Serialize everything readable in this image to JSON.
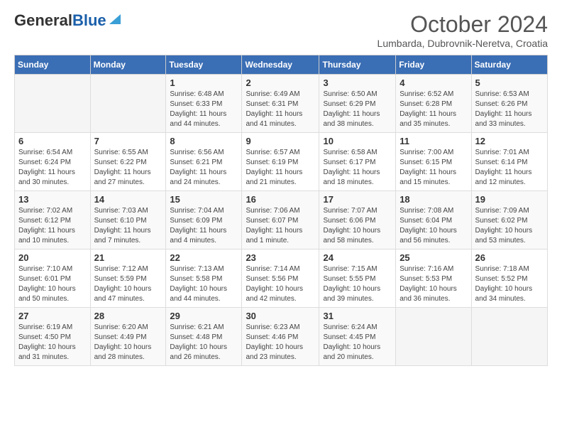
{
  "header": {
    "logo_general": "General",
    "logo_blue": "Blue",
    "month": "October 2024",
    "location": "Lumbarda, Dubrovnik-Neretva, Croatia"
  },
  "days_of_week": [
    "Sunday",
    "Monday",
    "Tuesday",
    "Wednesday",
    "Thursday",
    "Friday",
    "Saturday"
  ],
  "weeks": [
    [
      {
        "day": "",
        "info": ""
      },
      {
        "day": "",
        "info": ""
      },
      {
        "day": "1",
        "info": "Sunrise: 6:48 AM\nSunset: 6:33 PM\nDaylight: 11 hours and 44 minutes."
      },
      {
        "day": "2",
        "info": "Sunrise: 6:49 AM\nSunset: 6:31 PM\nDaylight: 11 hours and 41 minutes."
      },
      {
        "day": "3",
        "info": "Sunrise: 6:50 AM\nSunset: 6:29 PM\nDaylight: 11 hours and 38 minutes."
      },
      {
        "day": "4",
        "info": "Sunrise: 6:52 AM\nSunset: 6:28 PM\nDaylight: 11 hours and 35 minutes."
      },
      {
        "day": "5",
        "info": "Sunrise: 6:53 AM\nSunset: 6:26 PM\nDaylight: 11 hours and 33 minutes."
      }
    ],
    [
      {
        "day": "6",
        "info": "Sunrise: 6:54 AM\nSunset: 6:24 PM\nDaylight: 11 hours and 30 minutes."
      },
      {
        "day": "7",
        "info": "Sunrise: 6:55 AM\nSunset: 6:22 PM\nDaylight: 11 hours and 27 minutes."
      },
      {
        "day": "8",
        "info": "Sunrise: 6:56 AM\nSunset: 6:21 PM\nDaylight: 11 hours and 24 minutes."
      },
      {
        "day": "9",
        "info": "Sunrise: 6:57 AM\nSunset: 6:19 PM\nDaylight: 11 hours and 21 minutes."
      },
      {
        "day": "10",
        "info": "Sunrise: 6:58 AM\nSunset: 6:17 PM\nDaylight: 11 hours and 18 minutes."
      },
      {
        "day": "11",
        "info": "Sunrise: 7:00 AM\nSunset: 6:15 PM\nDaylight: 11 hours and 15 minutes."
      },
      {
        "day": "12",
        "info": "Sunrise: 7:01 AM\nSunset: 6:14 PM\nDaylight: 11 hours and 12 minutes."
      }
    ],
    [
      {
        "day": "13",
        "info": "Sunrise: 7:02 AM\nSunset: 6:12 PM\nDaylight: 11 hours and 10 minutes."
      },
      {
        "day": "14",
        "info": "Sunrise: 7:03 AM\nSunset: 6:10 PM\nDaylight: 11 hours and 7 minutes."
      },
      {
        "day": "15",
        "info": "Sunrise: 7:04 AM\nSunset: 6:09 PM\nDaylight: 11 hours and 4 minutes."
      },
      {
        "day": "16",
        "info": "Sunrise: 7:06 AM\nSunset: 6:07 PM\nDaylight: 11 hours and 1 minute."
      },
      {
        "day": "17",
        "info": "Sunrise: 7:07 AM\nSunset: 6:06 PM\nDaylight: 10 hours and 58 minutes."
      },
      {
        "day": "18",
        "info": "Sunrise: 7:08 AM\nSunset: 6:04 PM\nDaylight: 10 hours and 56 minutes."
      },
      {
        "day": "19",
        "info": "Sunrise: 7:09 AM\nSunset: 6:02 PM\nDaylight: 10 hours and 53 minutes."
      }
    ],
    [
      {
        "day": "20",
        "info": "Sunrise: 7:10 AM\nSunset: 6:01 PM\nDaylight: 10 hours and 50 minutes."
      },
      {
        "day": "21",
        "info": "Sunrise: 7:12 AM\nSunset: 5:59 PM\nDaylight: 10 hours and 47 minutes."
      },
      {
        "day": "22",
        "info": "Sunrise: 7:13 AM\nSunset: 5:58 PM\nDaylight: 10 hours and 44 minutes."
      },
      {
        "day": "23",
        "info": "Sunrise: 7:14 AM\nSunset: 5:56 PM\nDaylight: 10 hours and 42 minutes."
      },
      {
        "day": "24",
        "info": "Sunrise: 7:15 AM\nSunset: 5:55 PM\nDaylight: 10 hours and 39 minutes."
      },
      {
        "day": "25",
        "info": "Sunrise: 7:16 AM\nSunset: 5:53 PM\nDaylight: 10 hours and 36 minutes."
      },
      {
        "day": "26",
        "info": "Sunrise: 7:18 AM\nSunset: 5:52 PM\nDaylight: 10 hours and 34 minutes."
      }
    ],
    [
      {
        "day": "27",
        "info": "Sunrise: 6:19 AM\nSunset: 4:50 PM\nDaylight: 10 hours and 31 minutes."
      },
      {
        "day": "28",
        "info": "Sunrise: 6:20 AM\nSunset: 4:49 PM\nDaylight: 10 hours and 28 minutes."
      },
      {
        "day": "29",
        "info": "Sunrise: 6:21 AM\nSunset: 4:48 PM\nDaylight: 10 hours and 26 minutes."
      },
      {
        "day": "30",
        "info": "Sunrise: 6:23 AM\nSunset: 4:46 PM\nDaylight: 10 hours and 23 minutes."
      },
      {
        "day": "31",
        "info": "Sunrise: 6:24 AM\nSunset: 4:45 PM\nDaylight: 10 hours and 20 minutes."
      },
      {
        "day": "",
        "info": ""
      },
      {
        "day": "",
        "info": ""
      }
    ]
  ]
}
